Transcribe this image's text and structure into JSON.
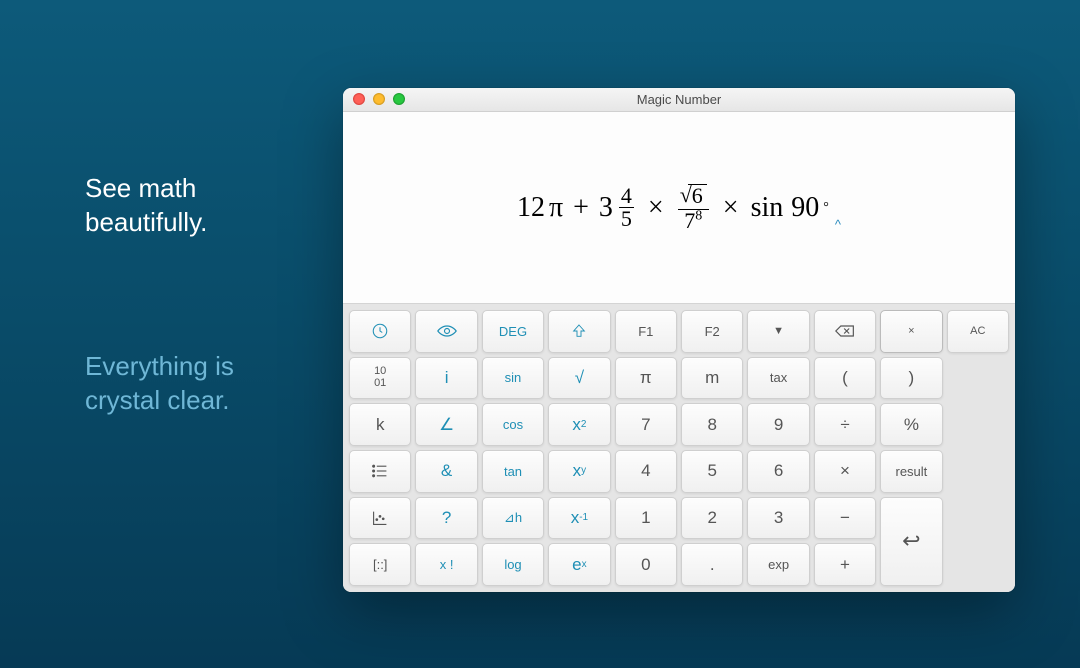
{
  "promo": {
    "line1a": "See math",
    "line1b": "beautifully.",
    "line2a": "Everything is",
    "line2b": "crystal clear."
  },
  "window": {
    "title": "Magic Number"
  },
  "expression": {
    "term1_coef": "12",
    "term1_pi": "π",
    "plus": "+",
    "term2_whole": "3",
    "term2_num": "4",
    "term2_den": "5",
    "times": "×",
    "term3_rad": "6",
    "term3_den_base": "7",
    "term3_den_exp": "8",
    "term4_func": "sin",
    "term4_arg": "90",
    "term4_deg": "°",
    "caret": "^"
  },
  "keys": {
    "r0": [
      "",
      "",
      "DEG",
      "",
      "F1",
      "F2",
      "▼",
      "",
      "×",
      "AC"
    ],
    "r1": [
      "10\n01",
      "i",
      "sin",
      "√",
      "π",
      "m",
      "tax",
      "(",
      ")"
    ],
    "r2": [
      "k",
      "∠",
      "cos",
      "x²",
      "7",
      "8",
      "9",
      "÷",
      "%"
    ],
    "r3": [
      "",
      "&",
      "tan",
      "xʸ",
      "4",
      "5",
      "6",
      "×",
      "result"
    ],
    "r4": [
      "",
      "?",
      "⊿h",
      "x⁻¹",
      "1",
      "2",
      "3",
      "−",
      "↩"
    ],
    "r5": [
      "[::]",
      "x !",
      "log",
      "eˣ",
      "0",
      ".",
      "exp",
      "+"
    ]
  },
  "icons": {
    "clock": "clock-icon",
    "eye": "eye-icon",
    "shift": "shift-icon",
    "delete": "delete-icon",
    "list": "list-icon",
    "chart": "chart-icon"
  }
}
